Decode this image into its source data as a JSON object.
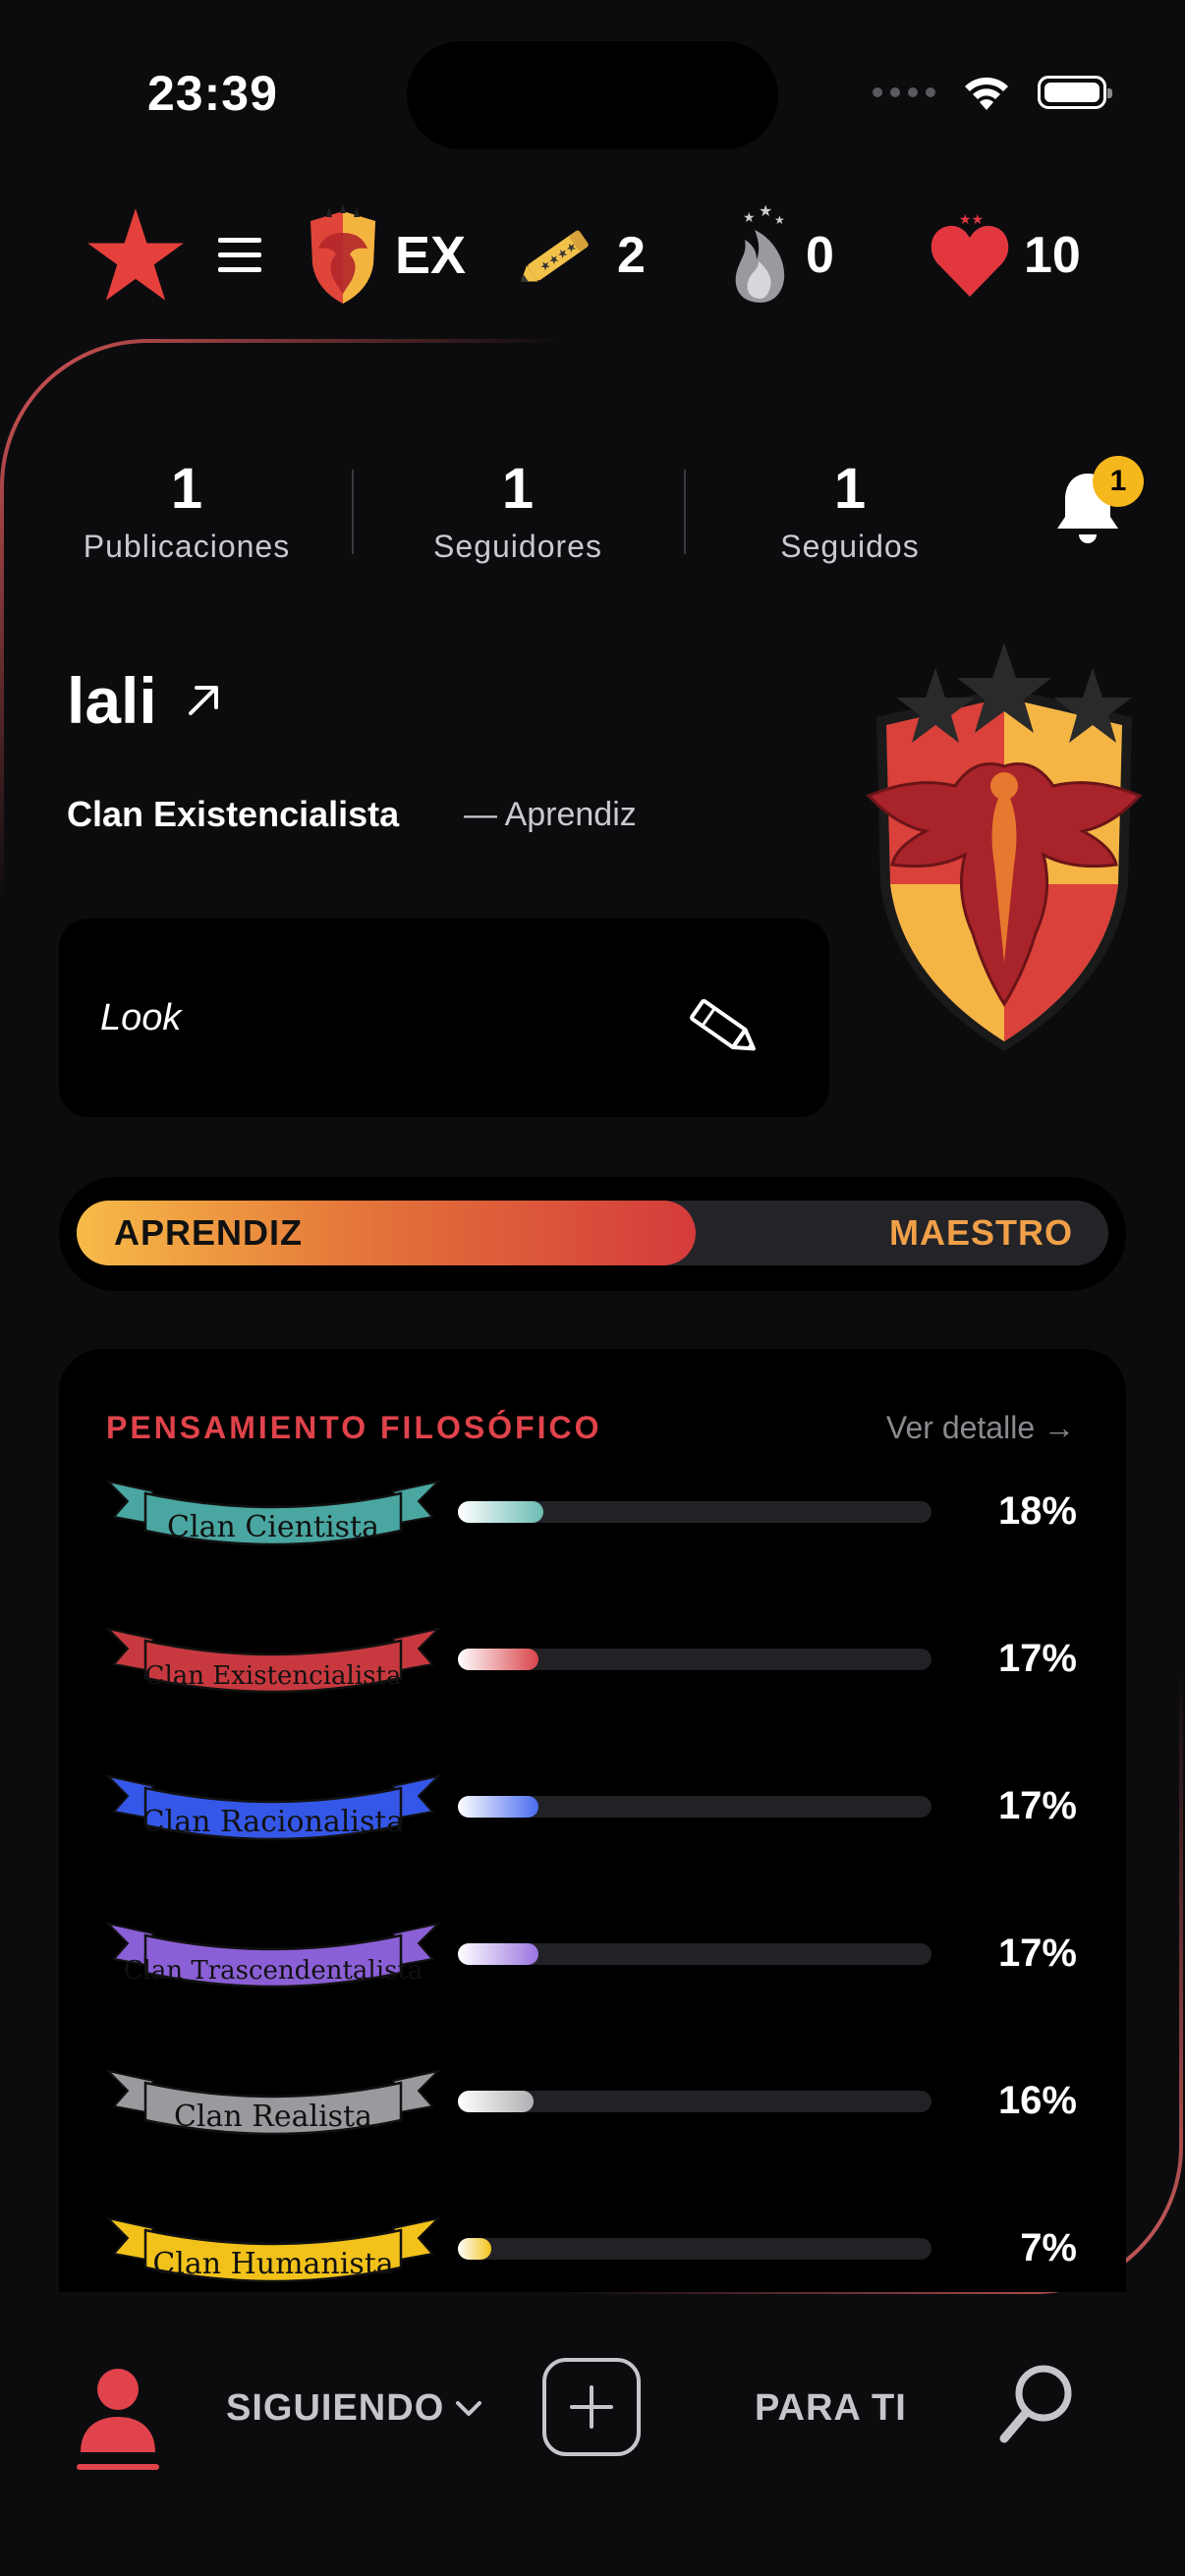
{
  "status_bar": {
    "time": "23:39"
  },
  "top_stats": {
    "clan_code": "EX",
    "pencils": "2",
    "flames": "0",
    "hearts": "10"
  },
  "counters": [
    {
      "value": "1",
      "label": "Publicaciones"
    },
    {
      "value": "1",
      "label": "Seguidores"
    },
    {
      "value": "1",
      "label": "Seguidos"
    }
  ],
  "notifications": {
    "badge": "1"
  },
  "profile": {
    "username": "lali",
    "clan": "Clan Existencialista",
    "rank": "— Aprendiz",
    "bio": "Look"
  },
  "level": {
    "from": "APRENDIZ",
    "to": "MAESTRO",
    "progress_percent": 60
  },
  "philosophy": {
    "title": "PENSAMIENTO FILOSÓFICO",
    "link": "Ver detalle →",
    "clans": [
      {
        "name": "Clan Cientista",
        "percent_label": "18%",
        "value": 18,
        "color": "#4aa6a0",
        "fill_from": "#ffffff",
        "fill_to": "#6bbcb4"
      },
      {
        "name": "Clan Existencialista",
        "percent_label": "17%",
        "value": 17,
        "color": "#c8393f",
        "fill_from": "#ffffff",
        "fill_to": "#d9454b"
      },
      {
        "name": "Clan Racionalista",
        "percent_label": "17%",
        "value": 17,
        "color": "#3557e8",
        "fill_from": "#ffffff",
        "fill_to": "#4a6cf0"
      },
      {
        "name": "Clan Trascendentalista",
        "percent_label": "17%",
        "value": 17,
        "color": "#8b5fd6",
        "fill_from": "#ffffff",
        "fill_to": "#9a74e0"
      },
      {
        "name": "Clan Realista",
        "percent_label": "16%",
        "value": 16,
        "color": "#9a9a9e",
        "fill_from": "#ffffff",
        "fill_to": "#b0b0b4"
      },
      {
        "name": "Clan Humanista",
        "percent_label": "7%",
        "value": 7,
        "color": "#f2c21a",
        "fill_from": "#ffffff",
        "fill_to": "#f2c21a"
      }
    ]
  },
  "bottom_nav": {
    "following": "SIGUIENDO",
    "for_you": "PARA TI"
  },
  "colors": {
    "accent_red": "#e0434b",
    "gold": "#f5b81c",
    "background": "#0c0c0f"
  }
}
